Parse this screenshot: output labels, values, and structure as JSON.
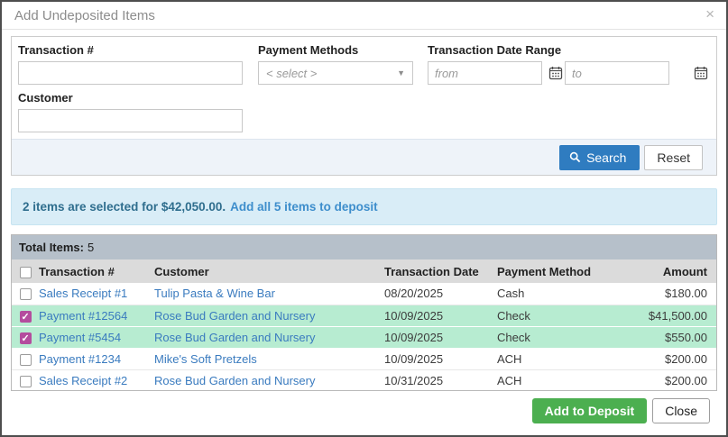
{
  "modal": {
    "title": "Add Undeposited Items",
    "close_icon": "×"
  },
  "filters": {
    "transaction_number": {
      "label": "Transaction #",
      "value": ""
    },
    "payment_methods": {
      "label": "Payment Methods",
      "selected_value": "< select >"
    },
    "date_range": {
      "label": "Transaction Date Range",
      "from_placeholder": "from",
      "to_placeholder": "to"
    },
    "customer": {
      "label": "Customer",
      "value": ""
    },
    "search_label": "Search",
    "reset_label": "Reset"
  },
  "banner": {
    "message": "2 items are selected for $42,050.00.",
    "link_label": "Add all 5 items to deposit"
  },
  "table": {
    "total_label": "Total Items:",
    "total_value": "5",
    "columns": [
      "Transaction #",
      "Customer",
      "Transaction Date",
      "Payment Method",
      "Amount"
    ],
    "rows": [
      {
        "transaction": "Sales Receipt #1",
        "customer": "Tulip Pasta & Wine Bar",
        "date": "08/20/2025",
        "method": "Cash",
        "amount": "$180.00",
        "selected": false
      },
      {
        "transaction": "Payment #12564",
        "customer": "Rose Bud Garden and Nursery",
        "date": "10/09/2025",
        "method": "Check",
        "amount": "$41,500.00",
        "selected": true
      },
      {
        "transaction": "Payment #5454",
        "customer": "Rose Bud Garden and Nursery",
        "date": "10/09/2025",
        "method": "Check",
        "amount": "$550.00",
        "selected": true
      },
      {
        "transaction": "Payment #1234",
        "customer": "Mike's Soft Pretzels",
        "date": "10/09/2025",
        "method": "ACH",
        "amount": "$200.00",
        "selected": false
      },
      {
        "transaction": "Sales Receipt #2",
        "customer": "Rose Bud Garden and Nursery",
        "date": "10/31/2025",
        "method": "ACH",
        "amount": "$200.00",
        "selected": false
      }
    ]
  },
  "footer": {
    "add_label": "Add to Deposit",
    "close_label": "Close"
  },
  "colors": {
    "search_blue": "#2f7cc0",
    "banner_bg": "#d9edf7",
    "banner_text": "#2f6e8e",
    "banner_link": "#3e8ecc",
    "totalbar_bg": "#b6c0ca",
    "row_green": "#b7ecd1",
    "check_magenta": "#b44d9e",
    "link_blue": "#3a7bbf",
    "add_green": "#4caf50"
  }
}
